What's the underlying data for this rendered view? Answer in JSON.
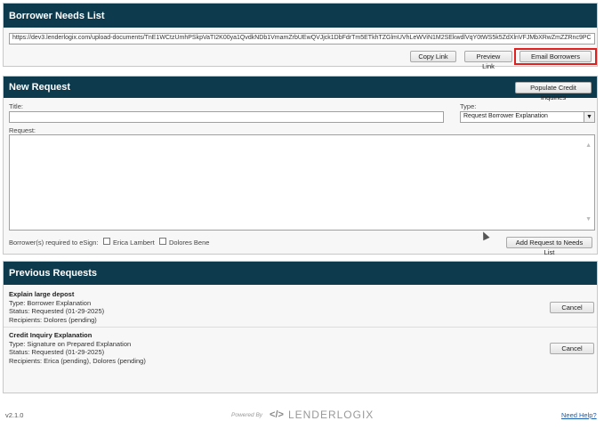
{
  "needs_list": {
    "title": "Borrower Needs List",
    "upload_url": "https://dev3.lenderlogix.com/upload-documents/TnE1WCtzUmhPSkpVaTI2K00ya1QvdkNDb1VmamZrbUEwQVJjck1DbFdrTm5ETkhTZGlmUVhLeWViN1M2SEkwdlVqY0tWS5k5ZdXlnVFJMbXRwZmZZRnc9PC",
    "copy_link": "Copy Link",
    "preview_link": "Preview Link",
    "email_borrowers": "Email Borrowers"
  },
  "new_request": {
    "title": "New Request",
    "populate_button": "Populate Credit Inquiries",
    "title_label": "Title:",
    "type_label": "Type:",
    "type_value": "Request Borrower Explanation",
    "request_label": "Request:",
    "esign_label": "Borrower(s) required to eSign:",
    "borrowers": [
      {
        "name": "Erica Lambert",
        "checked": false
      },
      {
        "name": "Dolores Bene",
        "checked": false
      }
    ],
    "add_button": "Add Request to Needs List"
  },
  "previous": {
    "title": "Previous Requests",
    "items": [
      {
        "title": "Explain large depost",
        "type": "Type: Borrower Explanation",
        "status": "Status: Requested (01-29-2025)",
        "recipients": "Recipients: Dolores (pending)",
        "cancel": "Cancel"
      },
      {
        "title": "Credit Inquiry Explanation",
        "type": "Type: Signature on Prepared Explanation",
        "status": "Status: Requested (01-29-2025)",
        "recipients": "Recipients: Erica (pending), Dolores (pending)",
        "cancel": "Cancel"
      }
    ]
  },
  "footer": {
    "version": "v2.1.0",
    "powered_by": "Powered By",
    "brand": "LENDERLOGIX",
    "help": "Need Help?"
  },
  "colors": {
    "header_bg": "#0e3a4e",
    "highlight": "#e02020",
    "link": "#1a5fb4"
  }
}
